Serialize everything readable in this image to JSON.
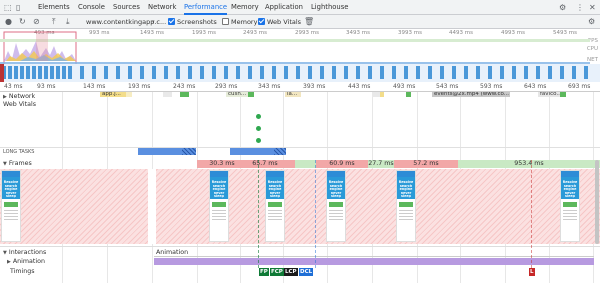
{
  "tabs": [
    "Elements",
    "Console",
    "Sources",
    "Network",
    "Performance",
    "Memory",
    "Application",
    "Lighthouse"
  ],
  "active_tab": "Performance",
  "toolbar": {
    "url": "www.contentkingapp.c...",
    "screenshots": "Screenshots",
    "memory": "Memory",
    "web_vitals": "Web Vitals"
  },
  "overview": {
    "ticks": [
      "493 ms",
      "993 ms",
      "1493 ms",
      "1993 ms",
      "2493 ms",
      "2993 ms",
      "3493 ms",
      "3993 ms",
      "4493 ms",
      "4993 ms",
      "5493 ms"
    ],
    "labels": {
      "fps": "FPS",
      "cpu": "CPU",
      "net": "NET"
    }
  },
  "ruler": [
    "43 ms",
    "93 ms",
    "143 ms",
    "193 ms",
    "243 ms",
    "293 ms",
    "343 ms",
    "393 ms",
    "443 ms",
    "493 ms",
    "543 ms",
    "593 ms",
    "643 ms",
    "693 ms"
  ],
  "tracks": {
    "network": "Network",
    "web_vitals": "Web Vitals",
    "long_tasks": "LONG TASKS",
    "frames": "Frames",
    "interactions": "Interactions",
    "animation_track": "Animation",
    "animation_bar": "Animation",
    "timings": "Timings"
  },
  "network_items": [
    "app.j...",
    "cush...",
    "la...",
    "events@2x.mp4 (www.co...",
    "favico..."
  ],
  "frame_labels": [
    "30.3 ms",
    "65.7 ms",
    "60.9 ms",
    "27.7 ms",
    "57.2 ms",
    "953.4 ms"
  ],
  "thumb_text": "Resolve search engine never sleep",
  "timing_markers": [
    "FP",
    "FCP",
    "LCP",
    "DCL",
    "L"
  ],
  "colors": {
    "accent": "#1a73e8",
    "frame_red": "#f2a7a7",
    "frame_green": "#c9e9c4",
    "long_task": "#5a8fe0",
    "animation": "#b79ae0",
    "fp": "#0f7a36",
    "lcp": "#1a1a1a",
    "dcl": "#1f6fd6",
    "l": "#c62828"
  }
}
